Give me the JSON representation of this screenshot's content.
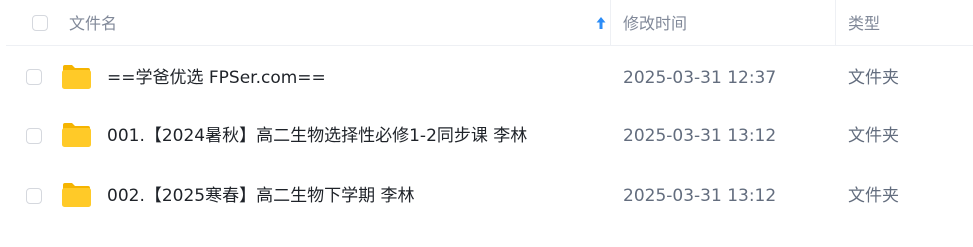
{
  "header": {
    "name_label": "文件名",
    "modified_label": "修改时间",
    "type_label": "类型",
    "sort_icon": "arrow-up-icon"
  },
  "colors": {
    "accent": "#2b8cf7",
    "folder": "#ffca28",
    "folder_dark": "#f5b400",
    "header_text": "#818999",
    "name_text": "#1f2329",
    "cell_text": "#636d7e",
    "divider": "#eef0f4"
  },
  "files": [
    {
      "icon": "folder-icon",
      "name": "==学爸优选 FPSer.com==",
      "modified": "2025-03-31 12:37",
      "type": "文件夹"
    },
    {
      "icon": "folder-icon",
      "name": "001.【2024暑秋】高二生物选择性必修1-2同步课 李林",
      "modified": "2025-03-31 13:12",
      "type": "文件夹"
    },
    {
      "icon": "folder-icon",
      "name": "002.【2025寒春】高二生物下学期 李林",
      "modified": "2025-03-31 13:12",
      "type": "文件夹"
    }
  ]
}
